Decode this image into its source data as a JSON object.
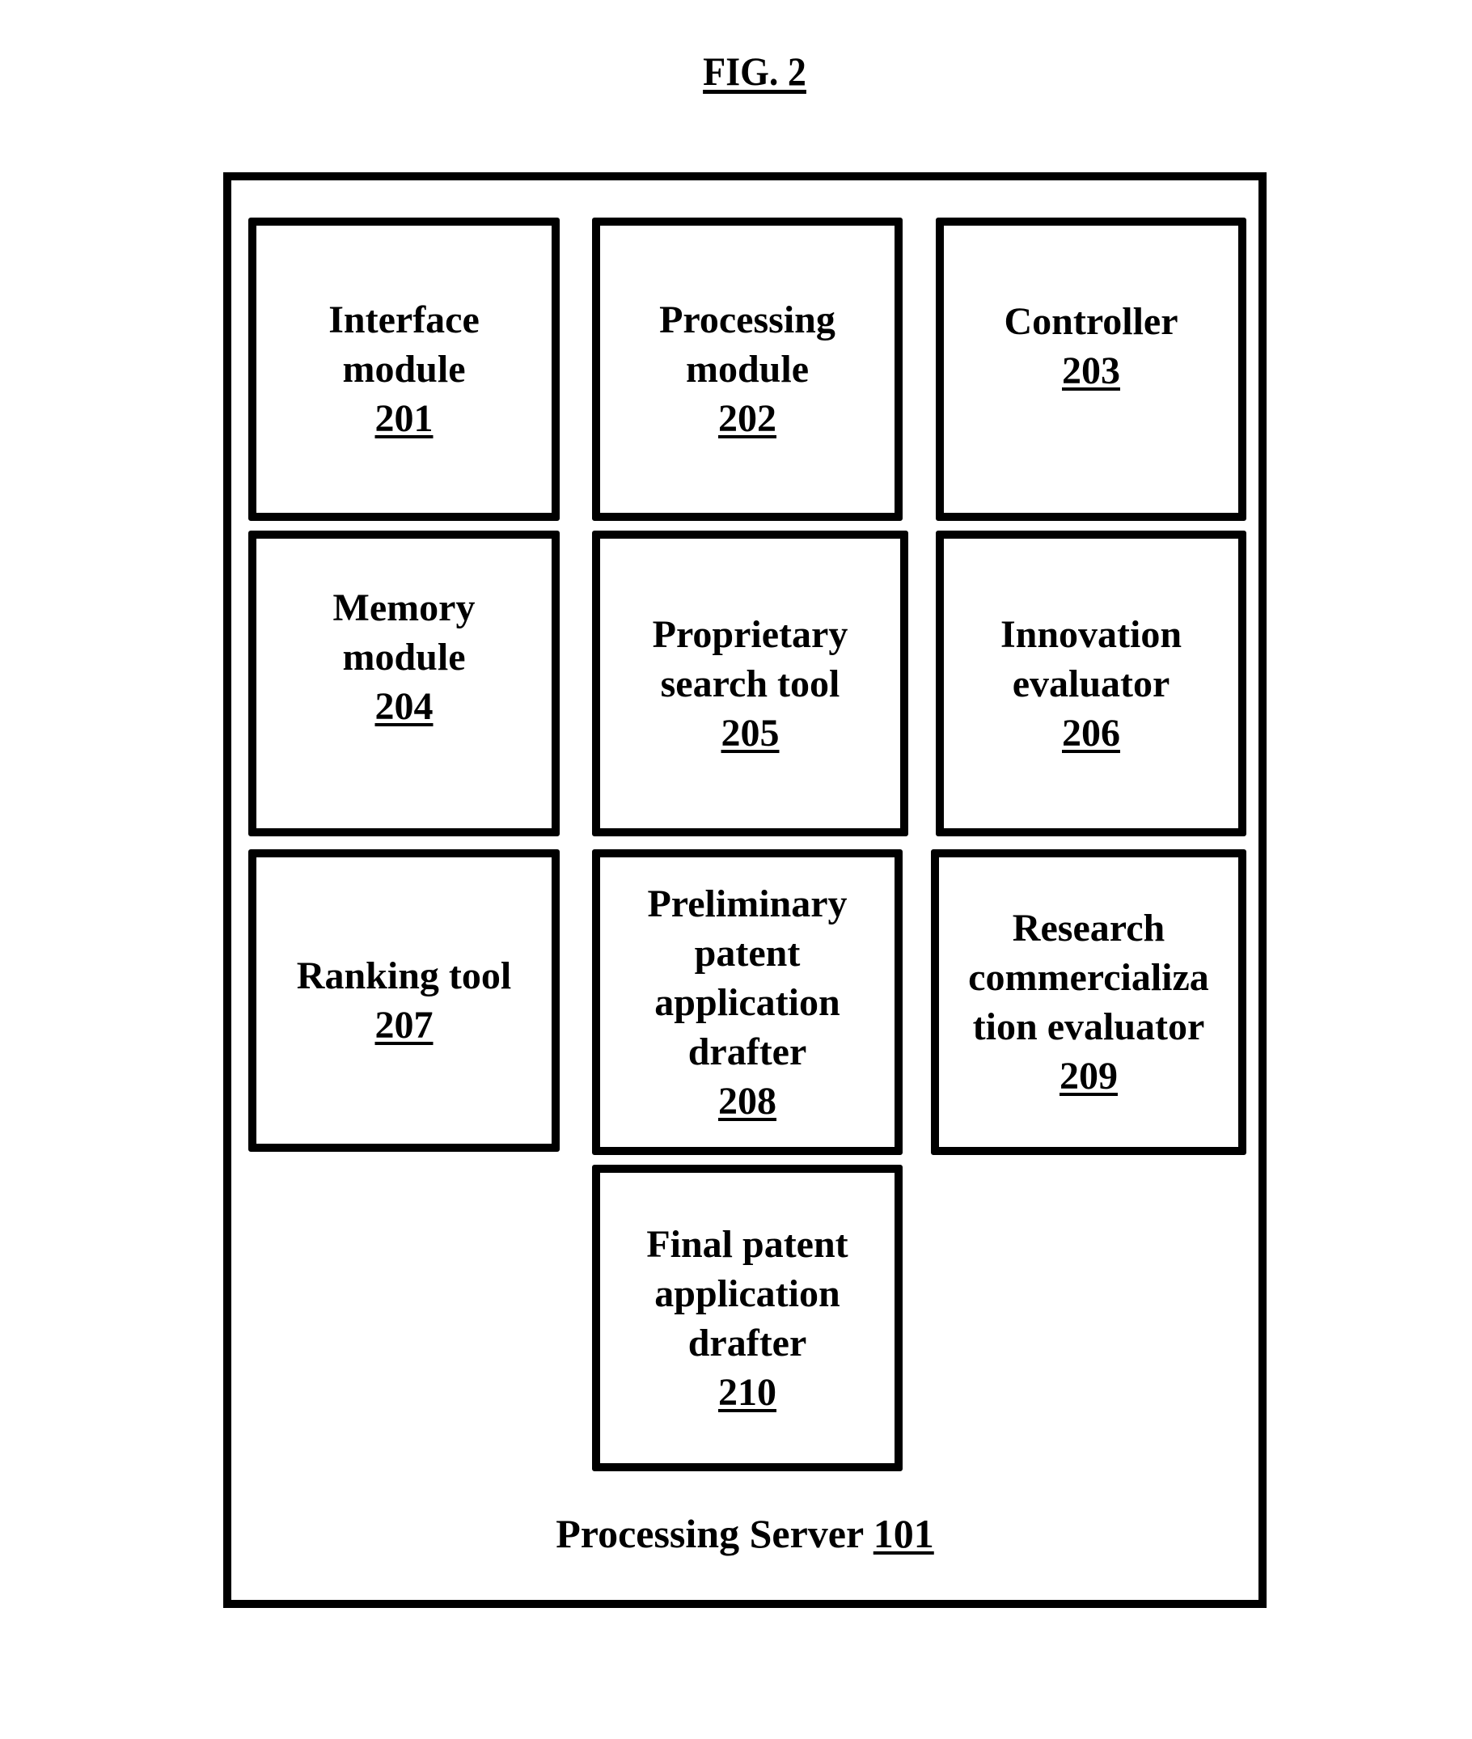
{
  "figure": {
    "title": "FIG. 2"
  },
  "server": {
    "label": "Processing Server",
    "ref": "101"
  },
  "modules": [
    {
      "lines": [
        "Interface",
        "module"
      ],
      "ref": "201"
    },
    {
      "lines": [
        "Processing",
        "module"
      ],
      "ref": "202"
    },
    {
      "lines": [
        "Controller"
      ],
      "ref": "203"
    },
    {
      "lines": [
        "Memory",
        "module"
      ],
      "ref": "204"
    },
    {
      "lines": [
        "Proprietary",
        "search tool"
      ],
      "ref": "205"
    },
    {
      "lines": [
        "Innovation",
        "evaluator"
      ],
      "ref": "206"
    },
    {
      "lines": [
        "Ranking tool"
      ],
      "ref": "207"
    },
    {
      "lines": [
        "Preliminary",
        "patent",
        "application",
        "drafter"
      ],
      "ref": "208"
    },
    {
      "lines": [
        "Research",
        "commercializa",
        "tion evaluator"
      ],
      "ref": "209"
    },
    {
      "lines": [
        "Final patent",
        "application",
        "drafter"
      ],
      "ref": "210"
    }
  ]
}
